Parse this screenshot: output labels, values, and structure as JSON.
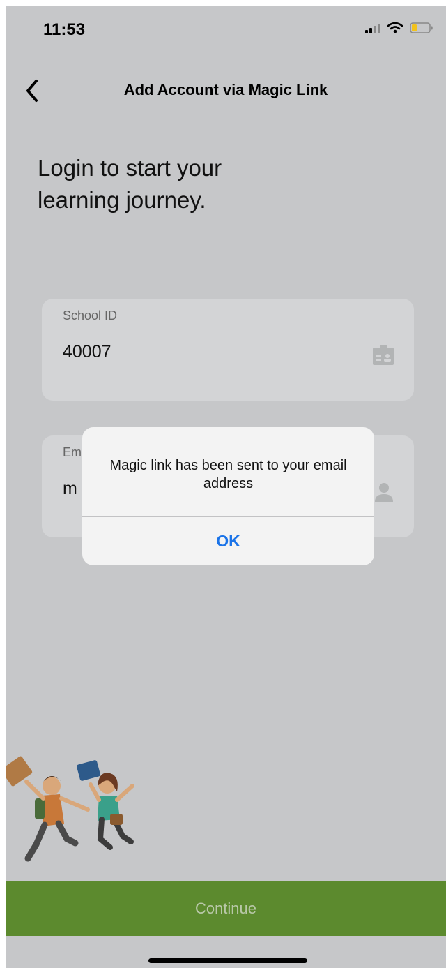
{
  "status_bar": {
    "time": "11:53"
  },
  "nav": {
    "title": "Add Account via Magic Link"
  },
  "headline": "Login to start your\nlearning journey.",
  "form": {
    "school_id": {
      "label": "School ID",
      "value": "40007"
    },
    "email": {
      "label": "Em",
      "value": "m"
    }
  },
  "alert": {
    "message": "Magic link has been sent to your email address",
    "ok_label": "OK"
  },
  "footer": {
    "continue_label": "Continue"
  },
  "colors": {
    "accent_green": "#5c8a2e",
    "alert_button_blue": "#1a73e8",
    "dim_overlay_bg": "#c6c7c9"
  },
  "icons": {
    "back": "chevron-left-icon",
    "school_id": "id-card-icon",
    "email": "person-icon"
  }
}
